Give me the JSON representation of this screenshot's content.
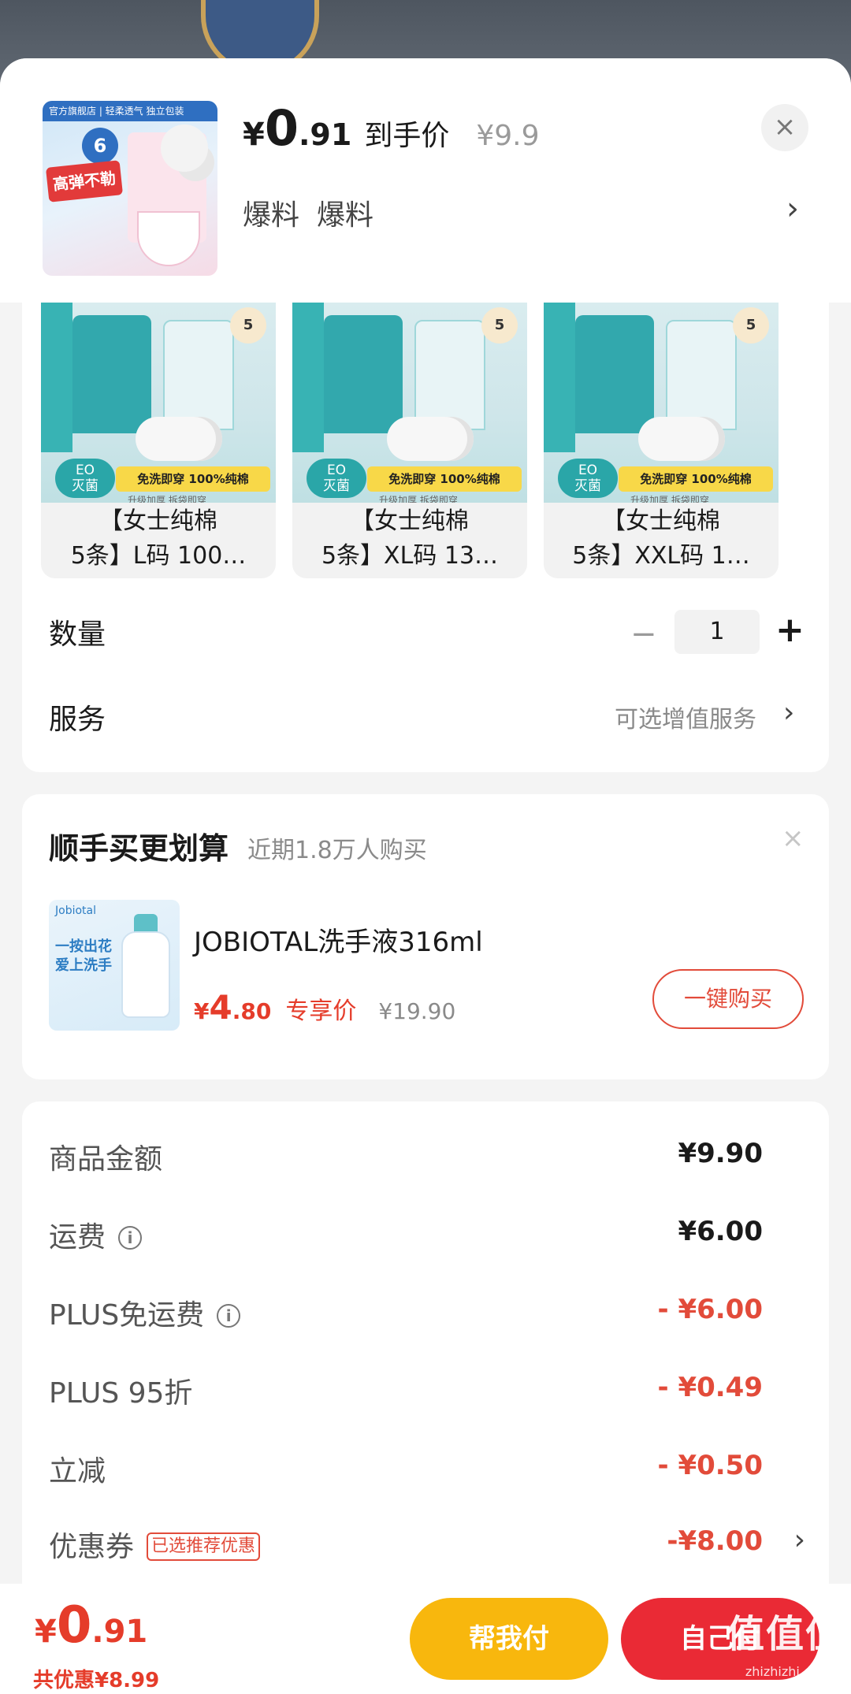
{
  "header": {
    "price_currency": "¥",
    "price_integer": "0",
    "price_decimal": ".91",
    "price_label": "到手价",
    "original_price": "¥9.9",
    "close_icon": "×",
    "tags": [
      "爆料",
      "爆料"
    ],
    "tags_chevron": "›",
    "thumb": {
      "strip_text": "官方旗舰店 | 轻柔透气 独立包装",
      "bubble": "6",
      "red_tag": "高弹不勒"
    }
  },
  "variants": [
    {
      "line1": "【女士纯棉",
      "line2": "5条】L码 100…",
      "badge": "5",
      "eo": "EO\n灭菌",
      "banner": "免洗即穿 100%纯棉",
      "sub": "升级加厚 拆袋即穿"
    },
    {
      "line1": "【女士纯棉",
      "line2": "5条】XL码 13…",
      "badge": "5",
      "eo": "EO\n灭菌",
      "banner": "免洗即穿 100%纯棉",
      "sub": "升级加厚 拆袋即穿"
    },
    {
      "line1": "【女士纯棉",
      "line2": "5条】XXL码 1…",
      "badge": "5",
      "eo": "EO\n灭菌",
      "banner": "免洗即穿 100%纯棉",
      "sub": "升级加厚 拆袋即穿"
    }
  ],
  "quantity": {
    "label": "数量",
    "minus": "−",
    "value": "1",
    "plus": "+"
  },
  "service": {
    "label": "服务",
    "value": "可选增值服务",
    "chevron": "›"
  },
  "upsell": {
    "title": "顺手买更划算",
    "subtitle": "近期1.8万人购买",
    "close": "×",
    "image": {
      "brand": "Jobiotal",
      "slogan_1": "一按出花",
      "slogan_2": "爱上洗手"
    },
    "product_name": "JOBIOTAL洗手液316ml",
    "price_currency": "¥",
    "price_integer": "4",
    "price_decimal": ".80",
    "price_label": "专享价",
    "original_price": "¥19.90",
    "buy_label": "一键购买"
  },
  "costs": [
    {
      "label": "商品金额",
      "value": "¥9.90",
      "negative": false,
      "info": false
    },
    {
      "label": "运费",
      "value": "¥6.00",
      "negative": false,
      "info": true
    },
    {
      "label": "PLUS免运费",
      "value": "- ¥6.00",
      "negative": true,
      "info": true
    },
    {
      "label": "PLUS 95折",
      "value": "- ¥0.49",
      "negative": true,
      "info": false
    },
    {
      "label": "立减",
      "value": "- ¥0.50",
      "negative": true,
      "info": false
    }
  ],
  "coupon": {
    "label": "优惠券",
    "tag": "已选推荐优惠",
    "value": "-¥8.00",
    "chevron": "›"
  },
  "info_icon": "i",
  "bottom": {
    "total_currency": "¥",
    "total_integer": "0",
    "total_decimal": ".91",
    "saving": "共优惠¥8.99",
    "help_pay": "帮我付",
    "self_pay": "自己付"
  },
  "watermark": {
    "main": "值值值",
    "sub": "zhizhizhi.com"
  },
  "colors": {
    "accent_red": "#e53c2a",
    "pay_red": "#ea2a35",
    "help_yellow": "#f8b70d"
  }
}
